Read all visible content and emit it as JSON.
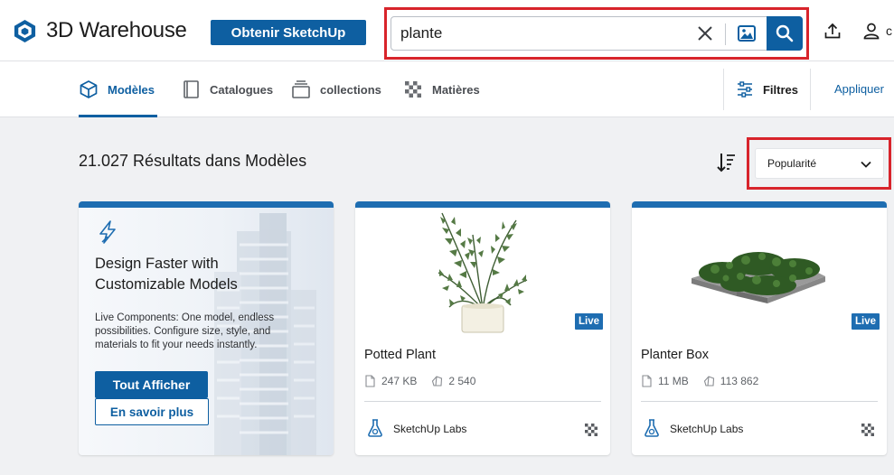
{
  "header": {
    "logo_text": "3D Warehouse",
    "get_button": "Obtenir SketchUp",
    "search_value": "plante",
    "user_initial": "c"
  },
  "tabs": [
    {
      "label": "Modèles",
      "icon": "cube-icon",
      "active": true
    },
    {
      "label": "Catalogues",
      "icon": "book-icon",
      "active": false
    },
    {
      "label": "collections",
      "icon": "collection-icon",
      "active": false
    },
    {
      "label": "Matières",
      "icon": "checker-icon",
      "active": false
    }
  ],
  "filters": {
    "label": "Filtres",
    "apply": "Appliquer"
  },
  "results": {
    "title": "21.027 Résultats dans Modèles"
  },
  "sort": {
    "selected": "Popularité"
  },
  "promo": {
    "title": "Design Faster with Customizable Models",
    "description": "Live Components: One model, endless possibilities. Configure size, style, and materials to fit your needs instantly.",
    "primary_button": "Tout Afficher",
    "secondary_button": "En savoir plus"
  },
  "cards": [
    {
      "badge": "Live",
      "name": "Potted Plant",
      "size": "247 KB",
      "count": "2 540",
      "author": "SketchUp Labs"
    },
    {
      "badge": "Live",
      "name": "Planter Box",
      "size": "11 MB",
      "count": "113 862",
      "author": "SketchUp Labs"
    }
  ],
  "colors": {
    "brand": "#0e5fa1",
    "card_accent": "#1e6db1",
    "highlight_box": "#d8242b"
  }
}
